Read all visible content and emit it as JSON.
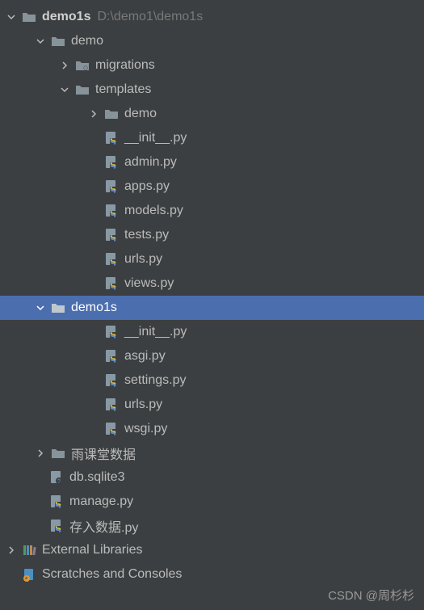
{
  "root": {
    "name": "demo1s",
    "path": "D:\\demo1\\demo1s"
  },
  "demo_folder": {
    "name": "demo"
  },
  "migrations": {
    "name": "migrations"
  },
  "templates": {
    "name": "templates"
  },
  "templates_demo": {
    "name": "demo"
  },
  "files_demo": [
    "__init__.py",
    "admin.py",
    "apps.py",
    "models.py",
    "tests.py",
    "urls.py",
    "views.py"
  ],
  "demo1s_folder": {
    "name": "demo1s"
  },
  "files_demo1s": [
    "__init__.py",
    "asgi.py",
    "settings.py",
    "urls.py",
    "wsgi.py"
  ],
  "yuketang": {
    "name": "雨课堂数据"
  },
  "root_files": [
    "db.sqlite3",
    "manage.py",
    "存入数据.py"
  ],
  "external_libraries": "External Libraries",
  "scratches": "Scratches and Consoles",
  "watermark": "CSDN @周杉杉"
}
